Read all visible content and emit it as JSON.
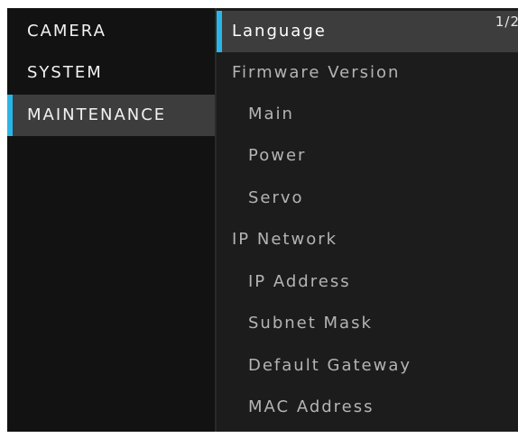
{
  "categories": [
    {
      "label": "CAMERA",
      "selected": false
    },
    {
      "label": "SYSTEM",
      "selected": false
    },
    {
      "label": "MAINTENANCE",
      "selected": true
    }
  ],
  "page_indicator": "1/2",
  "items": [
    {
      "label": "Language",
      "selected": true,
      "indent": false
    },
    {
      "label": "Firmware Version",
      "selected": false,
      "indent": false
    },
    {
      "label": "Main",
      "selected": false,
      "indent": true
    },
    {
      "label": "Power",
      "selected": false,
      "indent": true
    },
    {
      "label": "Servo",
      "selected": false,
      "indent": true
    },
    {
      "label": "IP Network",
      "selected": false,
      "indent": false
    },
    {
      "label": "IP Address",
      "selected": false,
      "indent": true
    },
    {
      "label": "Subnet Mask",
      "selected": false,
      "indent": true
    },
    {
      "label": "Default Gateway",
      "selected": false,
      "indent": true
    },
    {
      "label": "MAC Address",
      "selected": false,
      "indent": true
    }
  ],
  "colors": {
    "accent": "#29b6e6",
    "selected_bg": "#3d3d3d",
    "panel_bg": "#1c1c1c",
    "category_bg": "#121212"
  }
}
